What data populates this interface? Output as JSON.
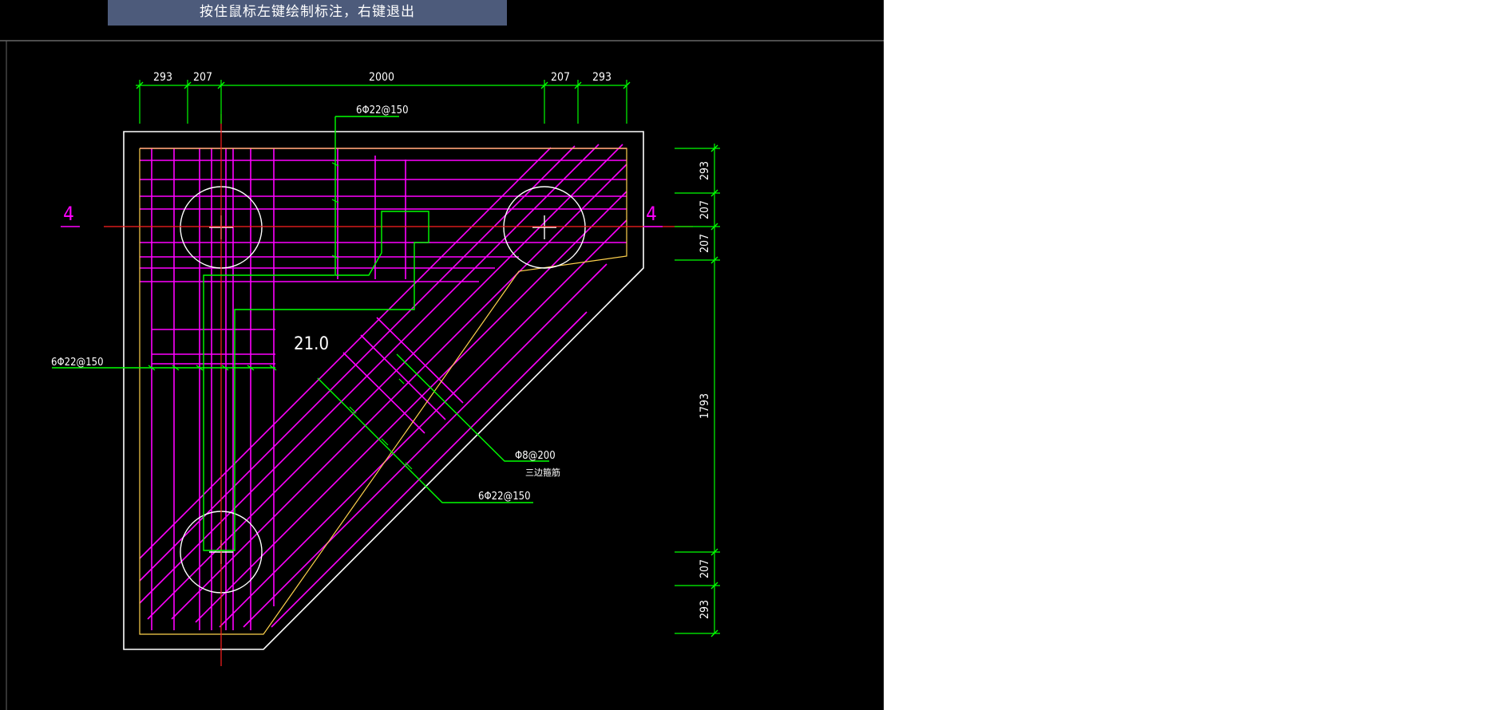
{
  "prompt_bar": {
    "text": "按住鼠标左键绘制标注，右键退出"
  },
  "colors": {
    "background": "#000000",
    "outline": "#ffffff",
    "dimension": "#00ff00",
    "rebar": "#ff00ff",
    "axis": "#ff0000",
    "inner_border": "#ffd24d"
  },
  "dimensions": {
    "top": [
      "293",
      "207",
      "2000",
      "207",
      "293"
    ],
    "right": [
      "293",
      "207",
      "207",
      "1793",
      "207",
      "293"
    ]
  },
  "section_mark": {
    "left": "4",
    "right": "4"
  },
  "elevation": "21.0",
  "annotations": {
    "top_rebar": "6Φ22@150",
    "left_rebar": "6Φ22@150",
    "diagonal_rebar": "6Φ22@150",
    "stirrup": "Φ8@200",
    "stirrup_note": "三边箍筋"
  }
}
